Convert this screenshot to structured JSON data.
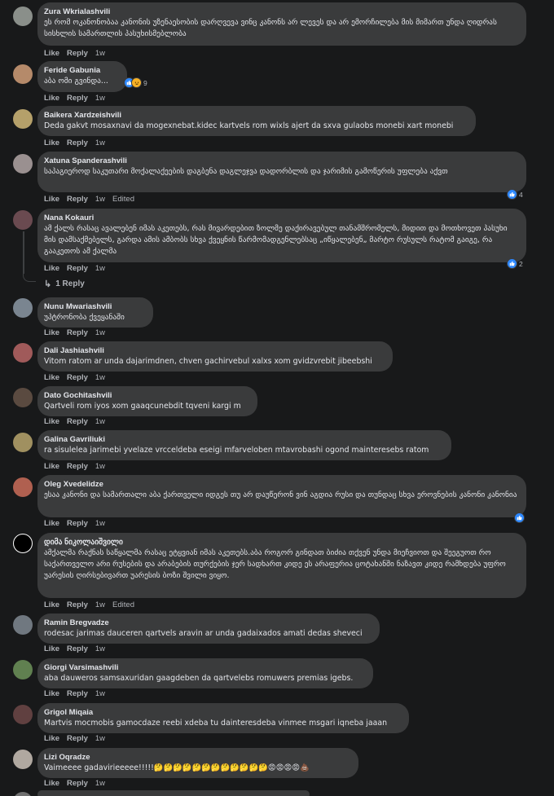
{
  "actions": {
    "like": "Like",
    "reply": "Reply",
    "edited": "Edited"
  },
  "comments": [
    {
      "author": "Zura Wkrialashvili",
      "text": "ეს რომ ოკანონობაა კანონის უზენაესობის დარღვევა ვინც კანონს არ ლევეს და არ ემორჩილება მის მიმართ უნდა ღიდრას სისხლის სამართლის პასუხისმებლობა",
      "time": "1w",
      "avatar": "#8a8f8a"
    },
    {
      "author": "Feride Gabunia",
      "text": "აბა ომი გვინდა...",
      "time": "1w",
      "avatar": "#b58a6a",
      "reaction_count": "9"
    },
    {
      "author": "Baikera Xardzeishvili",
      "text": "Deda gakvt mosaxnavi da mogexnebat.kidec kartvels rom wixls ajert da sxva gulaobs monebi xart monebi",
      "time": "1w",
      "avatar": "#b5a06a"
    },
    {
      "author": "Xatuna Spanderashvili",
      "text": "საპაგიეროდ საკუთარი მოქალაქეების დაგბენა დაგლეჯვა დადორბლის და ჯარიმის გამოწერის უფლება აქვთ",
      "time": "1w",
      "edited": true,
      "avatar": "#9a9090",
      "reaction_count": "4"
    },
    {
      "author": "Nana Kokauri",
      "text": "ამ ქალს რასაც ავალებენ იმას აკეთებს, რას მივარდებით ზოლმე დაქირავებულ თანამშრომელს, მიდით და მოთხოვეთ პასუხი მის დამსაქმებელს, გარდა ამის ამბობს სხვა ქვეყნის წარმომადგენლებსაც „იწყალებენ„ მარტო რუსულს რატომ გაიგე, რა გააკეთოს ამ ქალმა",
      "time": "1w",
      "avatar": "#6a4a50",
      "reaction_count": "2",
      "reply_text": "1 Reply"
    },
    {
      "author": "Nunu Mwariashvili",
      "text": "უპტრონობა ქვეყანაში",
      "time": "1w",
      "avatar": "#7a8590"
    },
    {
      "author": "Dali Jashiashvili",
      "text": "Vitom ratom ar unda dajarimdnen, chven gachirvebul xalxs xom gvidzvrebit jibeebshi",
      "time": "1w",
      "avatar": "#a05a5a"
    },
    {
      "author": "Dato Gochitashvili",
      "text": "Qartveli rom iyos xom gaaqcunebdit tqveni kargi m",
      "time": "1w",
      "avatar": "#5a4a40"
    },
    {
      "author": "Galina Gavriliuki",
      "text": "ra sisulelea jarimebi yvelaze vrcceldeba eseigi mfarveloben mtavrobashi ogond mainteresebs ratom",
      "time": "1w",
      "avatar": "#a09060"
    },
    {
      "author": "Oleg Xvedelidze",
      "text": "ესაა კანონი და სამართალი აბა ქართველი იდგეს თუ არ დაუწერონ ვინ აგდია რუსი და თუნდაც სხვა ეროვნების კანონი კანონია",
      "time": "1w",
      "avatar": "#b06050",
      "like_only": true
    },
    {
      "author": "დიმა ნიკოლაიშვილი",
      "text": "ამქალმა რაქნას საწყალმა რასაც ეტყვიან იმას აკეთებს.აბა როგორ გინდათ ბიძია თქვენ უნდა მიეჩვიოთ და შეეგუოთ რო საქართველო არი რუსების და არაბების თურქების ჯერ სადხართ კიდე ეს არაფერია ცოტახანში ნაზავთ კიდე რამხდება უფრო უარესის ღირსებივართ უარესის ბოზი შვილი ვიყო.",
      "time": "1w",
      "edited": true,
      "avatar": "#000000"
    },
    {
      "author": "Ramin Bregvadze",
      "text": "rodesac jarimas dauceren qartvels aravin ar unda gadaixados amati dedas sheveci",
      "time": "1w",
      "avatar": "#707880"
    },
    {
      "author": "Giorgi Varsimashvili",
      "text": "aba dauweros samsaxuridan gaagdeben da qartvelebs romuwers premias igebs.",
      "time": "1w",
      "avatar": "#608050"
    },
    {
      "author": "Grigol Miqaia",
      "text": "Martvis mocmobis gamocdaze reebi xdeba tu dainteresdeba vinmee msgari iqneba jaaan",
      "time": "1w",
      "avatar": "#604040"
    },
    {
      "author": "Lizi Oqradze",
      "text": "Vaimeeee gadavirieeeee!!!!!🤔🤔🤔🤔🤔🤔🤔🤔🤔🤔🤔🤔😡😡😡😡💩",
      "time": "1w",
      "avatar": "#b0a8a0"
    }
  ]
}
